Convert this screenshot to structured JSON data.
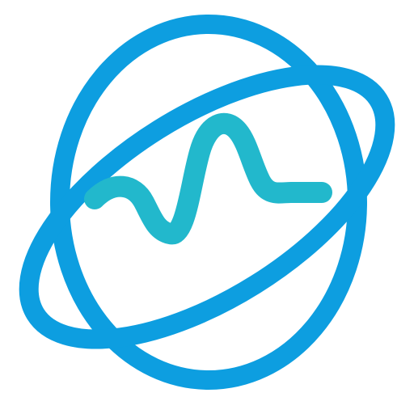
{
  "logo": {
    "name": "planet-wave-logo",
    "icon": "planet-with-ring-and-signal-wave-icon",
    "colors": {
      "globe": "#0d9ee0",
      "ring": "#0d9ee0",
      "wave": "#22b8cc",
      "background": "#ffffff"
    }
  }
}
